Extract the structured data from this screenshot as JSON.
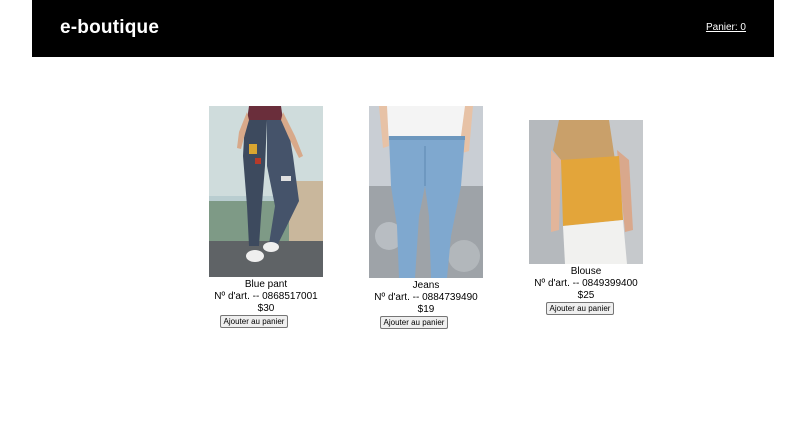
{
  "header": {
    "brand": "e-boutique",
    "cart_link": "Panier: 0"
  },
  "products": [
    {
      "name": "Blue pant",
      "sku": "Nº d'art. -- 0868517001",
      "price": "$30",
      "button_label": "Ajouter au panier"
    },
    {
      "name": "Jeans",
      "sku": "Nº d'art. -- 0884739490",
      "price": "$19",
      "button_label": "Ajouter au panier"
    },
    {
      "name": "Blouse",
      "sku": "Nº d'art. -- 0849399400",
      "price": "$25",
      "button_label": "Ajouter au panier"
    }
  ],
  "colors": {
    "header_bg": "#000000",
    "page_bg": "#ffffff",
    "denim_light": "#8fb4d8",
    "denim_dark": "#3c4a5e",
    "blouse_mustard": "#e3a53a"
  }
}
